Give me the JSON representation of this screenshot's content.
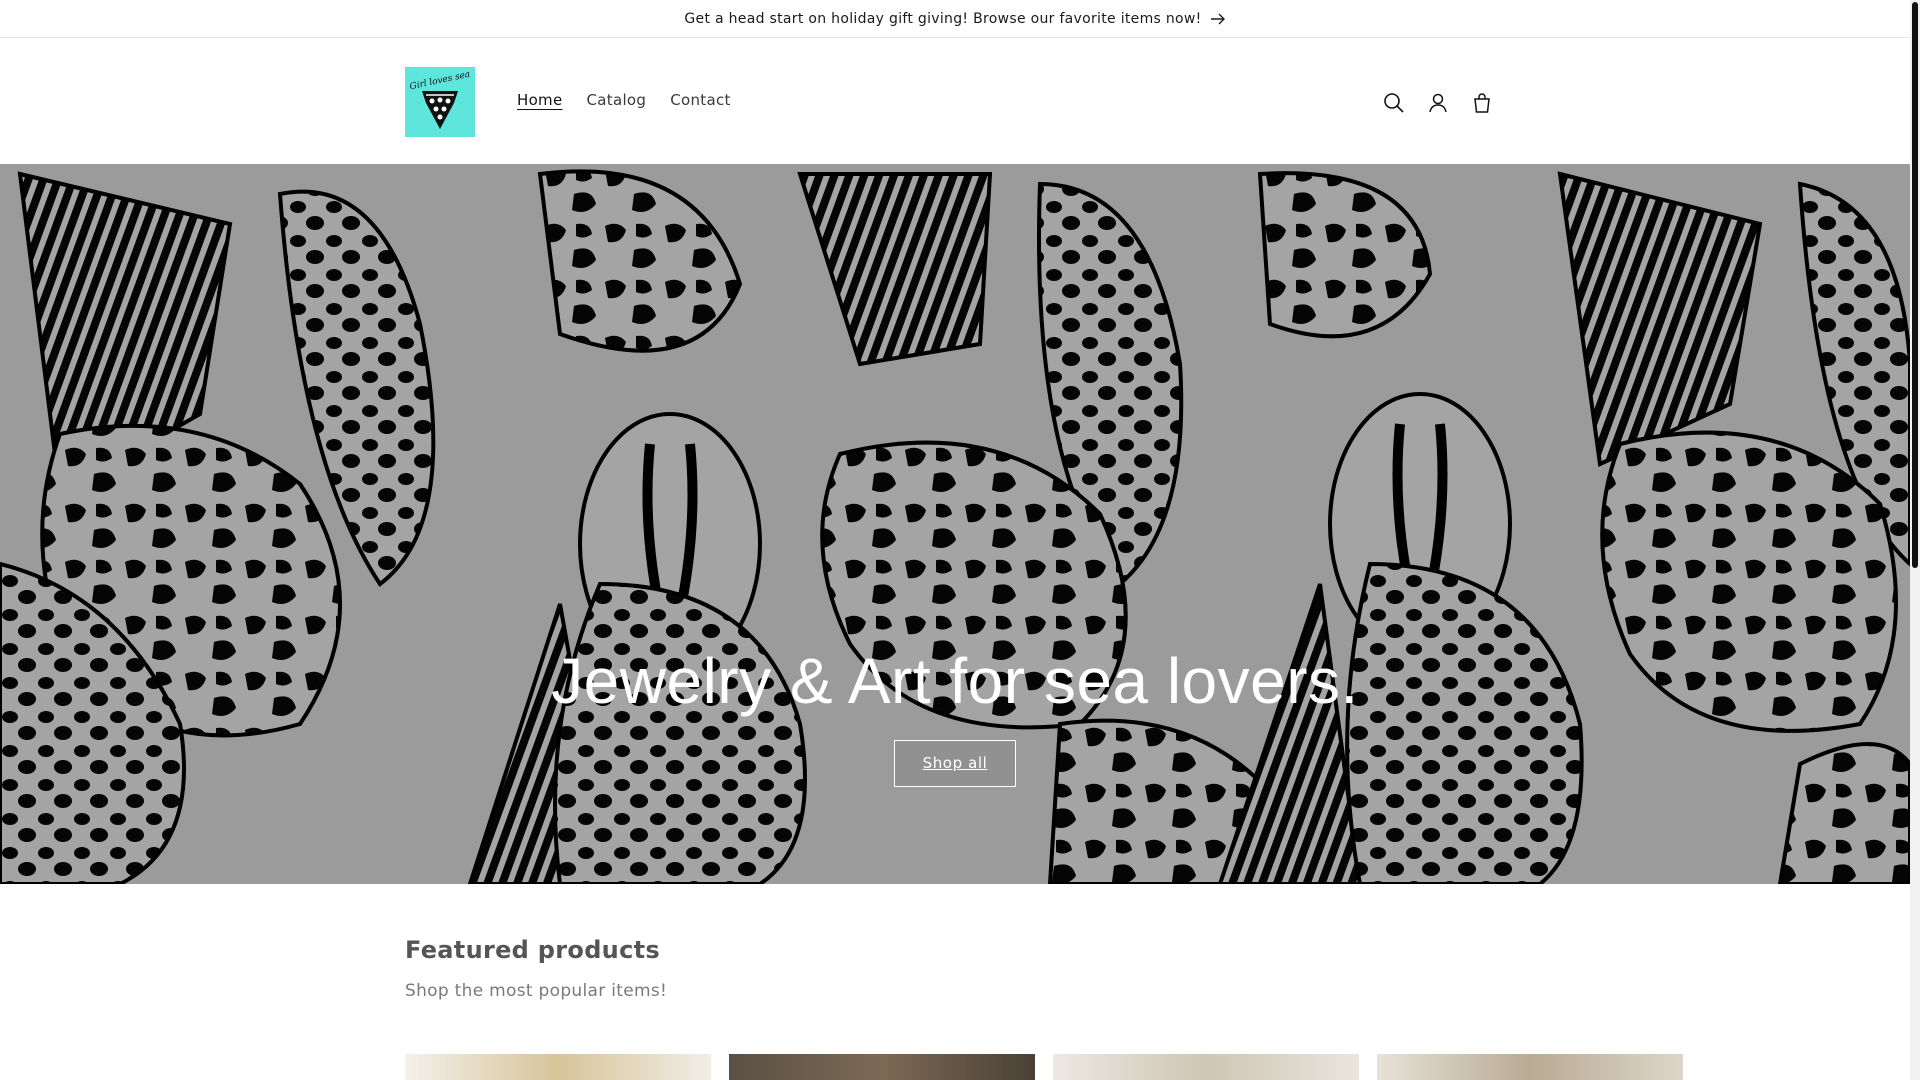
{
  "announcement": {
    "text": "Get a head start on holiday gift giving! Browse our favorite items now!"
  },
  "header": {
    "logo_text": "Girl loves sea",
    "nav": [
      {
        "label": "Home"
      },
      {
        "label": "Catalog"
      },
      {
        "label": "Contact"
      }
    ],
    "icons": [
      "search-icon",
      "account-icon",
      "cart-icon"
    ]
  },
  "hero": {
    "title": "Jewelry & Art for sea lovers.",
    "button_label": "Shop all"
  },
  "featured": {
    "title": "Featured products",
    "subtitle": "Shop the most popular items!"
  },
  "colors": {
    "logo_bg": "#5ee6dc",
    "hero_bg": "#9a9a9a",
    "text": "#121212"
  }
}
